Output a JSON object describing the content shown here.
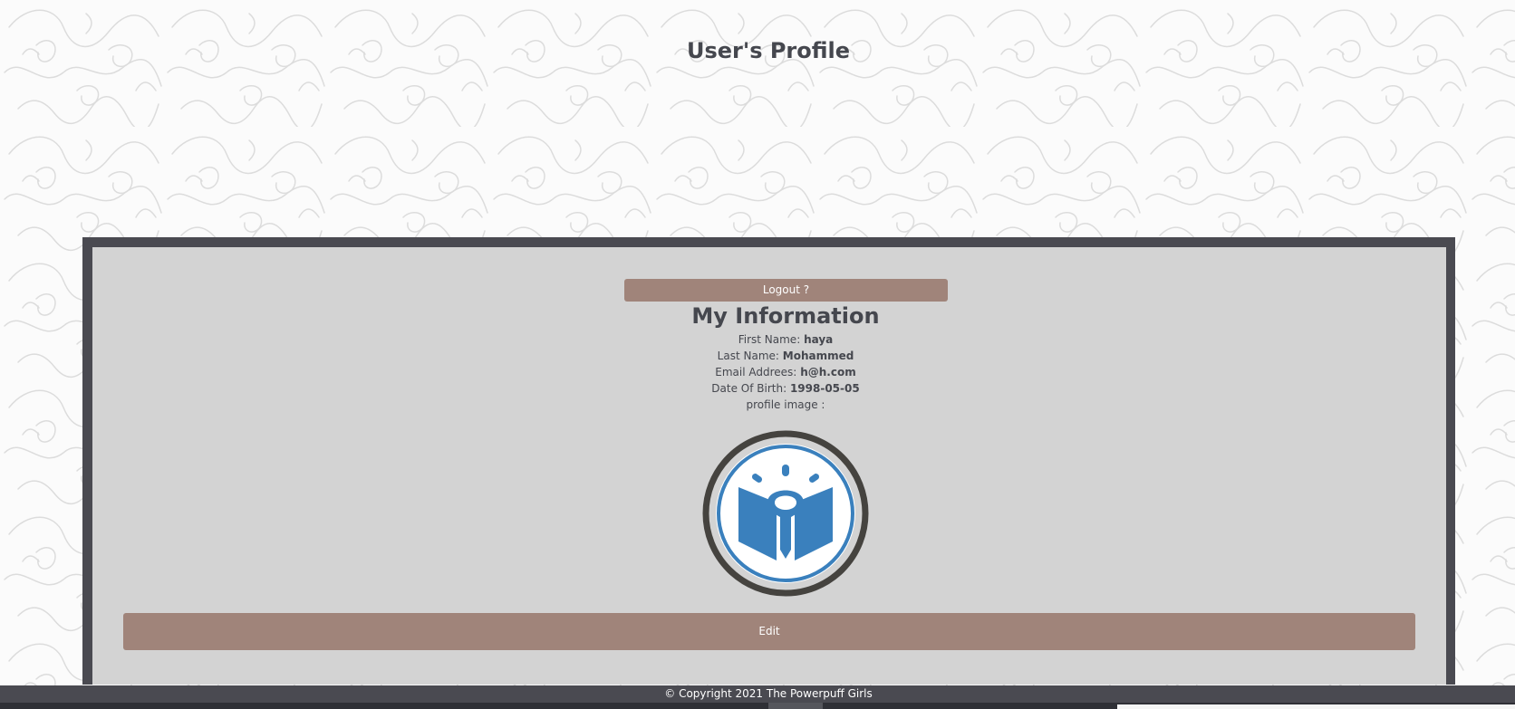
{
  "page": {
    "title": "User's Profile"
  },
  "profile_card": {
    "logout_label": "Logout ?",
    "heading": "My Information",
    "fields": [
      {
        "label": "First Name:",
        "value": "haya"
      },
      {
        "label": "Last Name:",
        "value": "Mohammed"
      },
      {
        "label": "Email Addrees:",
        "value": "h@h.com"
      },
      {
        "label": "Date Of Birth:",
        "value": "1998-05-05"
      }
    ],
    "profile_image_label": "profile image :",
    "edit_label": "Edit"
  },
  "footer": {
    "text": "© Copyright 2021 The Powerpuff Girls"
  },
  "colors": {
    "button": "#a0847a",
    "card_border": "#4a4a51",
    "card_bg": "#d3d3d3",
    "text": "#45474e",
    "logo_blue": "#3a80bd"
  },
  "icons": {
    "avatar": "book-lightbulb-logo-icon"
  }
}
